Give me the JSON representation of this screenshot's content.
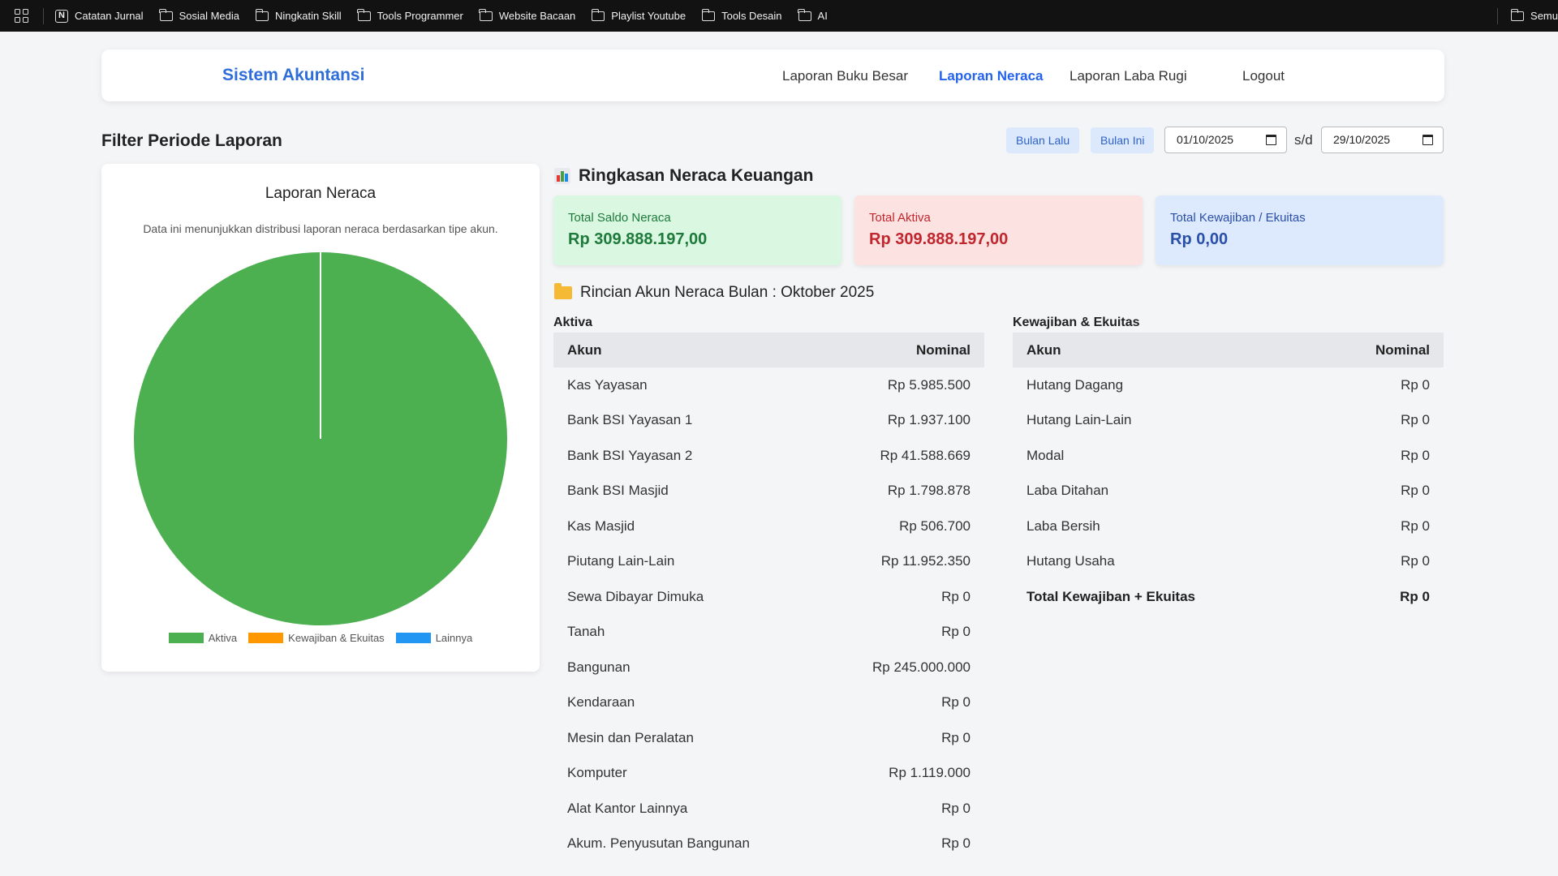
{
  "bookmarks": {
    "items": [
      {
        "label": "Catatan Jurnal",
        "icon": "notion-icon"
      },
      {
        "label": "Sosial Media",
        "icon": "folder-icon"
      },
      {
        "label": "Ningkatin Skill",
        "icon": "folder-icon"
      },
      {
        "label": "Tools Programmer",
        "icon": "folder-icon"
      },
      {
        "label": "Website Bacaan",
        "icon": "folder-icon"
      },
      {
        "label": "Playlist Youtube",
        "icon": "folder-icon"
      },
      {
        "label": "Tools Desain",
        "icon": "folder-icon"
      },
      {
        "label": "AI",
        "icon": "folder-icon"
      }
    ],
    "overflow_label": "Semu"
  },
  "navbar": {
    "brand": "Sistem Akuntansi",
    "links": [
      {
        "label": "Laporan Buku Besar",
        "active": false
      },
      {
        "label": "Laporan Neraca",
        "active": true
      },
      {
        "label": "Laporan Laba Rugi",
        "active": false
      },
      {
        "label": "Logout",
        "active": false
      }
    ]
  },
  "filter": {
    "title": "Filter Periode Laporan",
    "prev_month_label": "Bulan Lalu",
    "this_month_label": "Bulan Ini",
    "date_from": "01/10/2025",
    "separator": "s/d",
    "date_to": "29/10/2025"
  },
  "chart_card": {
    "title": "Laporan Neraca",
    "description": "Data ini menunjukkan distribusi laporan neraca berdasarkan tipe akun."
  },
  "chart_data": {
    "type": "pie",
    "title": "Laporan Neraca",
    "categories": [
      "Aktiva",
      "Kewajiban & Ekuitas",
      "Lainnya"
    ],
    "values": [
      309888197,
      0,
      0
    ],
    "colors": [
      "#4caf50",
      "#ff9800",
      "#2196f3"
    ],
    "legend_position": "bottom"
  },
  "summary": {
    "title": "Ringkasan Neraca Keuangan",
    "cards": [
      {
        "label": "Total Saldo Neraca",
        "value": "Rp 309.888.197,00",
        "bg": "#d9f7e1",
        "color": "#1e7a3a"
      },
      {
        "label": "Total Aktiva",
        "value": "Rp 309.888.197,00",
        "bg": "#fde2e2",
        "color": "#c0262d"
      },
      {
        "label": "Total Kewajiban / Ekuitas",
        "value": "Rp 0,00",
        "bg": "#dde9fc",
        "color": "#2a4fa8"
      }
    ]
  },
  "detail": {
    "title": "Rincian Akun Neraca Bulan : Oktober 2025",
    "aktiva": {
      "title": "Aktiva",
      "col_account": "Akun",
      "col_amount": "Nominal",
      "rows": [
        {
          "account": "Kas Yayasan",
          "amount": "Rp 5.985.500"
        },
        {
          "account": "Bank BSI Yayasan 1",
          "amount": "Rp 1.937.100"
        },
        {
          "account": "Bank BSI Yayasan 2",
          "amount": "Rp 41.588.669"
        },
        {
          "account": "Bank BSI Masjid",
          "amount": "Rp 1.798.878"
        },
        {
          "account": "Kas Masjid",
          "amount": "Rp 506.700"
        },
        {
          "account": "Piutang Lain-Lain",
          "amount": "Rp 11.952.350"
        },
        {
          "account": "Sewa Dibayar Dimuka",
          "amount": "Rp 0"
        },
        {
          "account": "Tanah",
          "amount": "Rp 0"
        },
        {
          "account": "Bangunan",
          "amount": "Rp 245.000.000"
        },
        {
          "account": "Kendaraan",
          "amount": "Rp 0"
        },
        {
          "account": "Mesin dan Peralatan",
          "amount": "Rp 0"
        },
        {
          "account": "Komputer",
          "amount": "Rp 1.119.000"
        },
        {
          "account": "Alat Kantor Lainnya",
          "amount": "Rp 0"
        },
        {
          "account": "Akum. Penyusutan Bangunan",
          "amount": "Rp 0"
        }
      ]
    },
    "kewajiban": {
      "title": "Kewajiban & Ekuitas",
      "col_account": "Akun",
      "col_amount": "Nominal",
      "rows": [
        {
          "account": "Hutang Dagang",
          "amount": "Rp 0"
        },
        {
          "account": "Hutang Lain-Lain",
          "amount": "Rp 0"
        },
        {
          "account": "Modal",
          "amount": "Rp 0"
        },
        {
          "account": "Laba Ditahan",
          "amount": "Rp 0"
        },
        {
          "account": "Laba Bersih",
          "amount": "Rp 0"
        },
        {
          "account": "Hutang Usaha",
          "amount": "Rp 0"
        }
      ],
      "total_label": "Total Kewajiban + Ekuitas",
      "total_amount": "Rp 0"
    }
  }
}
